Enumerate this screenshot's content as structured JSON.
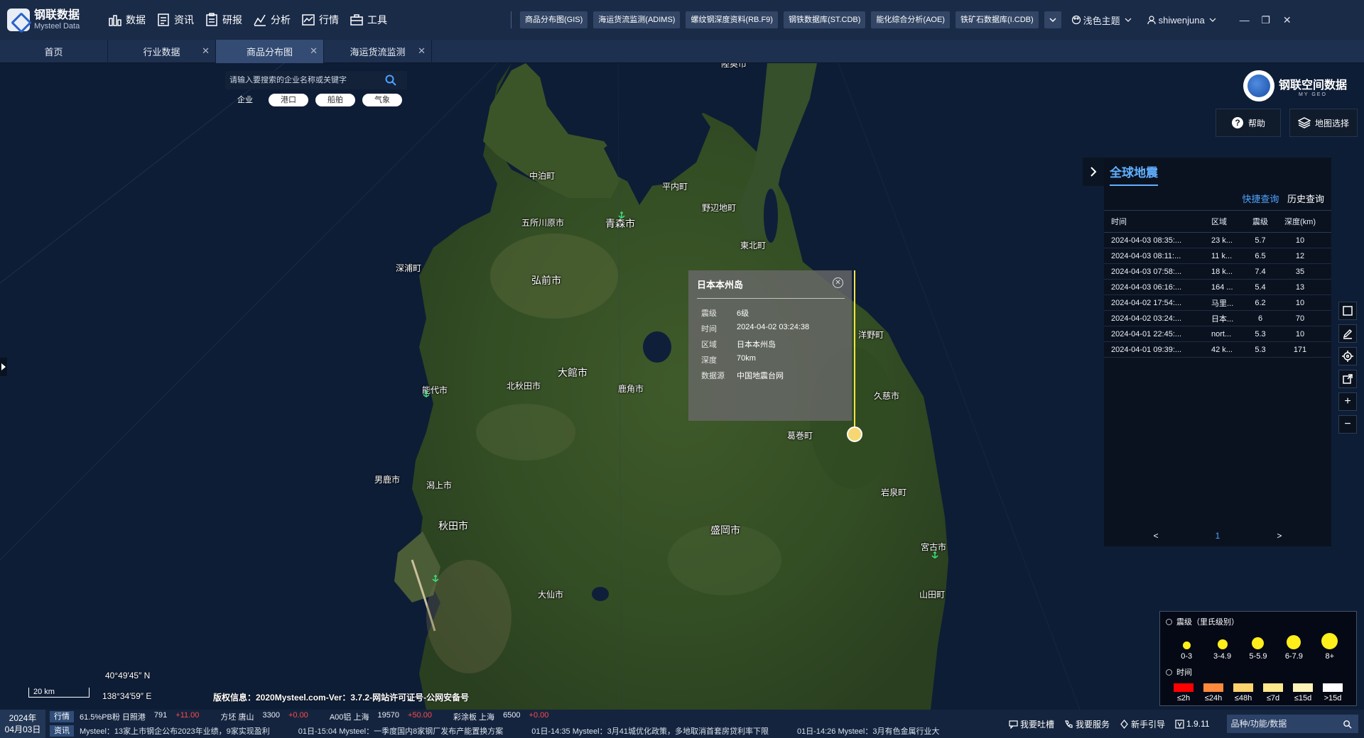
{
  "app": {
    "logo_name": "钢联数据",
    "logo_sub": "Mysteel Data"
  },
  "mainnav": [
    {
      "label": "数据",
      "icon": "bar-chart-icon"
    },
    {
      "label": "资讯",
      "icon": "news-icon"
    },
    {
      "label": "研报",
      "icon": "report-icon"
    },
    {
      "label": "分析",
      "icon": "analysis-icon"
    },
    {
      "label": "行情",
      "icon": "market-icon"
    },
    {
      "label": "工具",
      "icon": "toolbox-icon"
    }
  ],
  "db_tabs": [
    "商品分布图(GIS)",
    "海运货流监测(ADIMS)",
    "螺纹钢深度资料(RB.F9)",
    "钢铁数据库(ST.CDB)",
    "能化综合分析(AOE)",
    "铁矿石数据库(I.CDB)"
  ],
  "topright": {
    "theme": "浅色主题",
    "user": "shiwenjuna"
  },
  "page_tabs": [
    {
      "label": "首页",
      "closable": false,
      "active": false
    },
    {
      "label": "行业数据",
      "closable": true,
      "active": false
    },
    {
      "label": "商品分布图",
      "closable": true,
      "active": true
    },
    {
      "label": "海运货流监测",
      "closable": true,
      "active": false
    }
  ],
  "map": {
    "search_placeholder": "请输入要搜索的企业名称或关键字",
    "filters": {
      "active": "企业",
      "pills": [
        "港口",
        "船舶",
        "气象"
      ]
    },
    "brand": {
      "name": "钢联空间数据",
      "sub": "MY GEO"
    },
    "help_label": "帮助",
    "basemap_label": "地图选择",
    "places": [
      {
        "name": "陸奥市",
        "big": false
      },
      {
        "name": "中泊町",
        "big": false
      },
      {
        "name": "平内町",
        "big": false
      },
      {
        "name": "野辺地町",
        "big": false
      },
      {
        "name": "五所川原市",
        "big": false
      },
      {
        "name": "青森市",
        "big": true
      },
      {
        "name": "東北町",
        "big": false
      },
      {
        "name": "深浦町",
        "big": false
      },
      {
        "name": "弘前市",
        "big": true
      },
      {
        "name": "洋野町",
        "big": false
      },
      {
        "name": "大館市",
        "big": true
      },
      {
        "name": "能代市",
        "big": false
      },
      {
        "name": "北秋田市",
        "big": false
      },
      {
        "name": "鹿角市",
        "big": false
      },
      {
        "name": "久慈市",
        "big": false
      },
      {
        "name": "葛巻町",
        "big": false
      },
      {
        "name": "男鹿市",
        "big": false
      },
      {
        "name": "潟上市",
        "big": false
      },
      {
        "name": "岩泉町",
        "big": false
      },
      {
        "name": "秋田市",
        "big": true
      },
      {
        "name": "盛岡市",
        "big": true
      },
      {
        "name": "宮古市",
        "big": false
      },
      {
        "name": "大仙市",
        "big": false
      },
      {
        "name": "山田町",
        "big": false
      }
    ],
    "coords_lat": "40°49′45″ N",
    "coords_lon": "138°34′59″ E",
    "scale": "20 km",
    "copyright": "版权信息：2020Mysteel.com-Ver：3.7.2-网站许可证号-公网安备号"
  },
  "popup": {
    "title": "日本本州岛",
    "rows": [
      {
        "k": "震级",
        "v": "6级"
      },
      {
        "k": "时间",
        "v": "2024-04-02 03:24:38"
      },
      {
        "k": "区域",
        "v": "日本本州岛"
      },
      {
        "k": "深度",
        "v": "70km"
      },
      {
        "k": "数据源",
        "v": "中国地震台网"
      }
    ]
  },
  "panel": {
    "title": "全球地震",
    "quick_query": "快捷查询",
    "history_query": "历史查询",
    "columns": [
      "时间",
      "区域",
      "震级",
      "深度(km)"
    ],
    "rows": [
      {
        "time": "2024-04-03 08:35:...",
        "area": "23 k...",
        "mag": "5.7",
        "depth": "10"
      },
      {
        "time": "2024-04-03 08:11:...",
        "area": "11 k...",
        "mag": "6.5",
        "depth": "12"
      },
      {
        "time": "2024-04-03 07:58:...",
        "area": "18 k...",
        "mag": "7.4",
        "depth": "35"
      },
      {
        "time": "2024-04-03 06:16:...",
        "area": "164 ...",
        "mag": "5.4",
        "depth": "13"
      },
      {
        "time": "2024-04-02 17:54:...",
        "area": "马里...",
        "mag": "6.2",
        "depth": "10"
      },
      {
        "time": "2024-04-02 03:24:...",
        "area": "日本...",
        "mag": "6",
        "depth": "70"
      },
      {
        "time": "2024-04-01 22:45:...",
        "area": "nort...",
        "mag": "5.3",
        "depth": "10"
      },
      {
        "time": "2024-04-01 09:39:...",
        "area": "42 k...",
        "mag": "5.3",
        "depth": "171"
      }
    ],
    "page": "1"
  },
  "legend": {
    "mag_title": "震级（里氏级别）",
    "mag_classes": [
      "0-3",
      "3-4.9",
      "5-5.9",
      "6-7.9",
      "8+"
    ],
    "time_title": "时间",
    "time_classes": [
      {
        "label": "≤2h",
        "color": "#ff0000"
      },
      {
        "label": "≤24h",
        "color": "#ff8a3c"
      },
      {
        "label": "≤48h",
        "color": "#ffd26e"
      },
      {
        "label": "≤7d",
        "color": "#ffe78c"
      },
      {
        "label": "≤15d",
        "color": "#fff2b8"
      },
      {
        "label": ">15d",
        "color": "#ffffff"
      }
    ]
  },
  "bottombar": {
    "year": "2024年",
    "date": "04月03日",
    "market_label": "行情",
    "news_label": "资讯",
    "market": [
      {
        "name": "61.5%PB粉 日照港",
        "price": "791",
        "chg": "+11.00"
      },
      {
        "name": "方坯 唐山",
        "price": "3300",
        "chg": "+0.00"
      },
      {
        "name": "A00铝 上海",
        "price": "19570",
        "chg": "+50.00"
      },
      {
        "name": "彩涂板 上海",
        "price": "6500",
        "chg": "+0.00"
      }
    ],
    "news": [
      "Mysteel：13家上市钢企公布2023年业绩，9家实现盈利",
      "01日-15:04  Mysteel：一季度国内8家钢厂发布产能置换方案",
      "01日-14:35  Mysteel：3月41城优化政策，多地取消首套房贷利率下限",
      "01日-14:26  Mysteel：3月有色金属行业大"
    ],
    "links": [
      "我要吐槽",
      "我要服务",
      "新手引导"
    ],
    "version": "1.9.11",
    "search_placeholder": "品种/功能/数据"
  }
}
